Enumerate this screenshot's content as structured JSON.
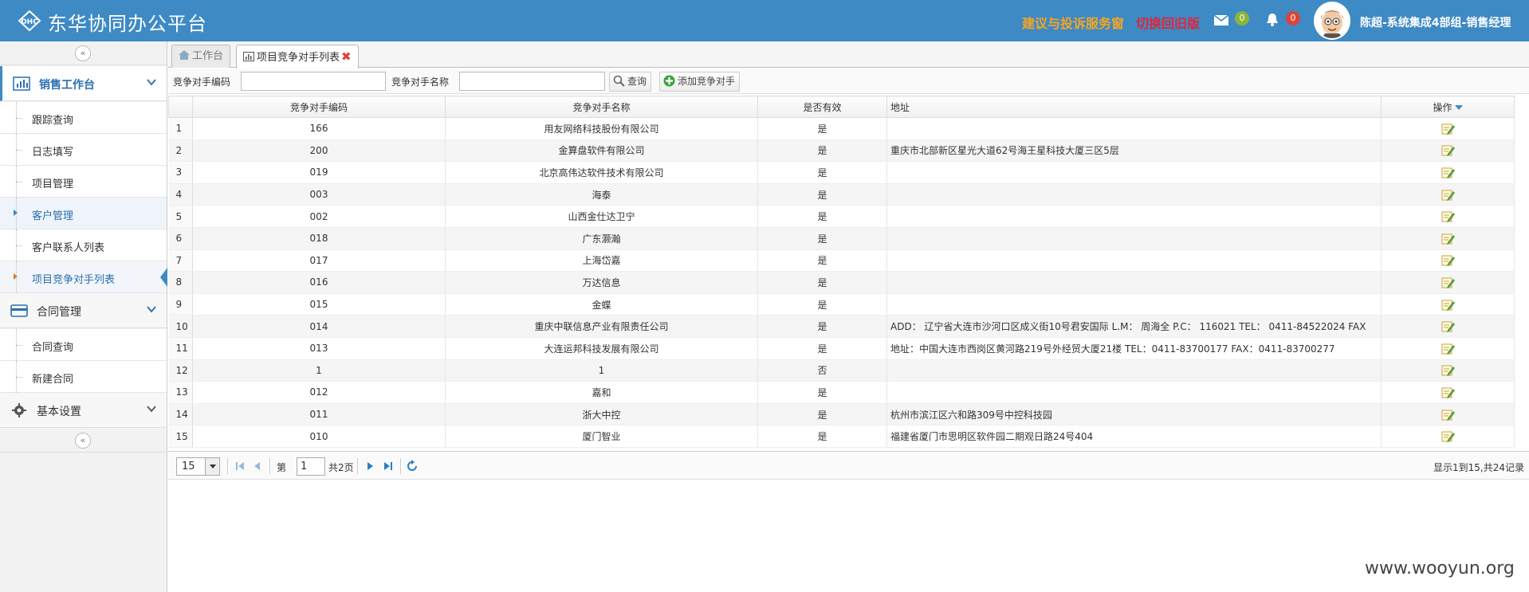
{
  "header": {
    "title": "东华协同办公平台",
    "suggest_link": "建议与投诉服务窗",
    "switch_link": "切换回旧版",
    "mail_count": "0",
    "notify_count": "0",
    "user": "陈超-系统集成4部组-销售经理",
    "colors": {
      "bar": "#3d8ac5",
      "suggest": "#f5a623",
      "switch": "#e0263a",
      "mail_badge": "#8bb43a",
      "notify_badge": "#d9443a"
    }
  },
  "sidebar": {
    "sections": [
      {
        "label": "销售工作台",
        "icon": "bar-chart-icon",
        "expanded": true,
        "items": [
          "跟踪查询",
          "日志填写",
          "项目管理",
          "客户管理",
          "客户联系人列表",
          "项目竞争对手列表"
        ]
      },
      {
        "label": "合同管理",
        "icon": "card-icon",
        "expanded": true,
        "items": [
          "合同查询",
          "新建合同"
        ]
      },
      {
        "label": "基本设置",
        "icon": "gear-icon",
        "expanded": false,
        "items": []
      }
    ]
  },
  "tabs": [
    {
      "label": "工作台",
      "icon": "home-icon",
      "active": false
    },
    {
      "label": "项目竞争对手列表",
      "icon": "chart-icon",
      "active": true
    }
  ],
  "toolbar": {
    "code_label": "竞争对手编码",
    "code_value": "",
    "name_label": "竞争对手名称",
    "name_value": "",
    "search_button": "查询",
    "add_button": "添加竞争对手"
  },
  "table": {
    "columns": [
      "",
      "竞争对手编码",
      "竞争对手名称",
      "是否有效",
      "地址",
      "操作"
    ],
    "rows": [
      {
        "n": "1",
        "code": "166",
        "name": "用友网络科技股份有限公司",
        "valid": "是",
        "addr": ""
      },
      {
        "n": "2",
        "code": "200",
        "name": "金算盘软件有限公司",
        "valid": "是",
        "addr": "重庆市北部新区星光大道62号海王星科技大厦三区5层"
      },
      {
        "n": "3",
        "code": "019",
        "name": "北京高伟达软件技术有限公司",
        "valid": "是",
        "addr": ""
      },
      {
        "n": "4",
        "code": "003",
        "name": "海泰",
        "valid": "是",
        "addr": ""
      },
      {
        "n": "5",
        "code": "002",
        "name": "山西金仕达卫宁",
        "valid": "是",
        "addr": ""
      },
      {
        "n": "6",
        "code": "018",
        "name": "广东灏瀚",
        "valid": "是",
        "addr": ""
      },
      {
        "n": "7",
        "code": "017",
        "name": "上海岱嘉",
        "valid": "是",
        "addr": ""
      },
      {
        "n": "8",
        "code": "016",
        "name": "万达信息",
        "valid": "是",
        "addr": ""
      },
      {
        "n": "9",
        "code": "015",
        "name": "金蝶",
        "valid": "是",
        "addr": ""
      },
      {
        "n": "10",
        "code": "014",
        "name": "重庆中联信息产业有限责任公司",
        "valid": "是",
        "addr": "ADD： 辽宁省大连市沙河口区成义街10号君安国际 L.M： 周海全 P.C： 116021 TEL： 0411-84522024 FAX"
      },
      {
        "n": "11",
        "code": "013",
        "name": "大连运邦科技发展有限公司",
        "valid": "是",
        "addr": "地址：中国大连市西岗区黄河路219号外经贸大厦21楼 TEL：0411-83700177 FAX：0411-83700277"
      },
      {
        "n": "12",
        "code": "1",
        "name": "1",
        "valid": "否",
        "addr": ""
      },
      {
        "n": "13",
        "code": "012",
        "name": "嘉和",
        "valid": "是",
        "addr": ""
      },
      {
        "n": "14",
        "code": "011",
        "name": "浙大中控",
        "valid": "是",
        "addr": "杭州市滨江区六和路309号中控科技园"
      },
      {
        "n": "15",
        "code": "010",
        "name": "厦门智业",
        "valid": "是",
        "addr": "福建省厦门市思明区软件园二期观日路24号404"
      }
    ]
  },
  "pager": {
    "page_size": "15",
    "page_prefix": "第",
    "page_value": "1",
    "page_total": "共2页",
    "info": "显示1到15,共24记录"
  },
  "watermark": "www.wooyun.org"
}
